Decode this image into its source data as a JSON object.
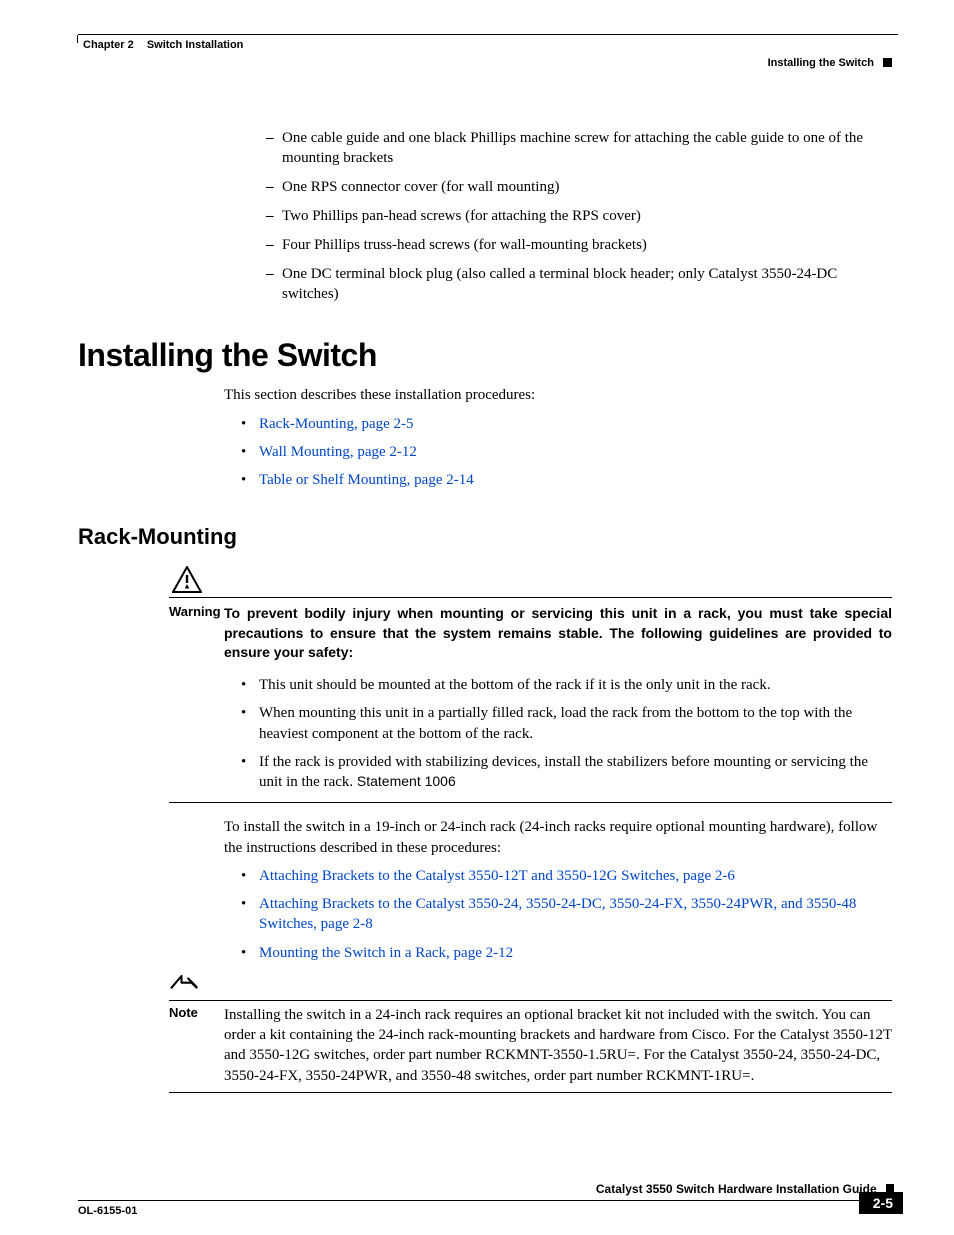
{
  "header": {
    "chapter_num": "Chapter 2",
    "chapter_title": "Switch Installation",
    "section_title": "Installing the Switch"
  },
  "dash_items": [
    "One cable guide and one black Phillips machine screw for attaching the cable guide to one of the mounting brackets",
    "One RPS connector cover (for wall mounting)",
    "Two Phillips pan-head screws (for attaching the RPS cover)",
    "Four Phillips truss-head screws (for wall-mounting brackets)",
    "One DC terminal block plug (also called a terminal block header; only Catalyst 3550-24-DC switches)"
  ],
  "h1": "Installing the Switch",
  "intro": "This section describes these installation procedures:",
  "proc_links": [
    "Rack-Mounting, page 2-5",
    "Wall Mounting, page 2-12",
    "Table or Shelf Mounting, page 2-14"
  ],
  "h2": "Rack-Mounting",
  "warning": {
    "label": "Warning",
    "text": "To prevent bodily injury when mounting or servicing this unit in a rack, you must take special precautions to ensure that the system remains stable. The following guidelines are provided to ensure your safety:",
    "bullets": [
      "This unit should be mounted at the bottom of the rack if it is the only unit in the rack.",
      "When mounting this unit in a partially filled rack, load the rack from the bottom to the top with the heaviest component at the bottom of the rack."
    ],
    "bullet3_text": "If the rack is provided with stabilizing devices, install the stabilizers before mounting or servicing the unit in the rack. ",
    "statement": "Statement 1006"
  },
  "install_para": "To install the switch in a 19-inch or 24-inch rack (24-inch racks require optional mounting hardware), follow the instructions described in these procedures:",
  "install_links": [
    "Attaching Brackets to the Catalyst 3550-12T and 3550-12G Switches, page 2-6",
    "Attaching Brackets to the Catalyst 3550-24, 3550-24-DC, 3550-24-FX, 3550-24PWR, and 3550-48 Switches, page 2-8",
    "Mounting the Switch in a Rack, page 2-12"
  ],
  "note": {
    "label": "Note",
    "text": "Installing the switch in a 24-inch rack requires an optional bracket kit not included with the switch. You can order a kit containing the 24-inch rack-mounting brackets and hardware from Cisco. For the Catalyst 3550-12T and 3550-12G switches, order part number RCKMNT-3550-1.5RU=. For the Catalyst 3550-24, 3550-24-DC, 3550-24-FX, 3550-24PWR, and 3550-48 switches, order part number RCKMNT-1RU=."
  },
  "footer": {
    "guide": "Catalyst 3550 Switch Hardware Installation Guide",
    "doc": "OL-6155-01",
    "page": "2-5"
  }
}
